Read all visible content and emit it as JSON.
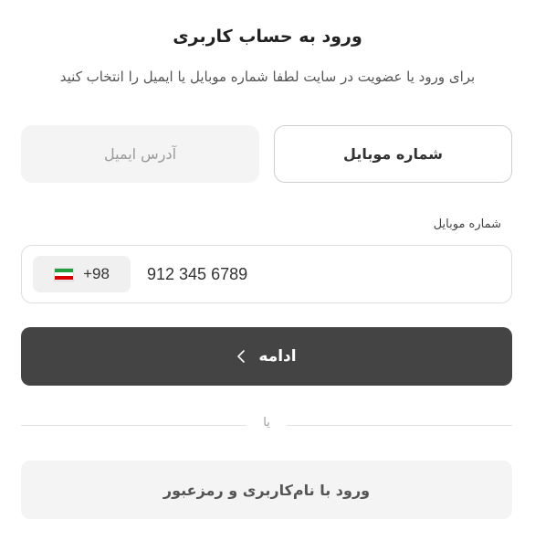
{
  "header": {
    "title": "ورود به حساب کاربری",
    "subtitle": "برای ورود یا عضویت در سایت لطفا شماره موبایل یا ایمیل را انتخاب کنید"
  },
  "tabs": {
    "mobile": "شماره موبایل",
    "email": "آدرس ایمیل",
    "active": "mobile"
  },
  "phone": {
    "label": "شماره موبایل",
    "country_code": "+98",
    "flag": "iran-flag-icon",
    "value": "912 345 6789"
  },
  "actions": {
    "continue_label": "ادامه",
    "continue_icon": "chevron-left-icon",
    "divider_text": "یا",
    "username_login_label": "ورود با نام‌کاربری و رمزعبور"
  },
  "colors": {
    "primary_button": "#444444",
    "secondary_button": "#f4f4f4",
    "flag_green": "#239f40",
    "flag_white": "#ffffff",
    "flag_red": "#da0000"
  }
}
